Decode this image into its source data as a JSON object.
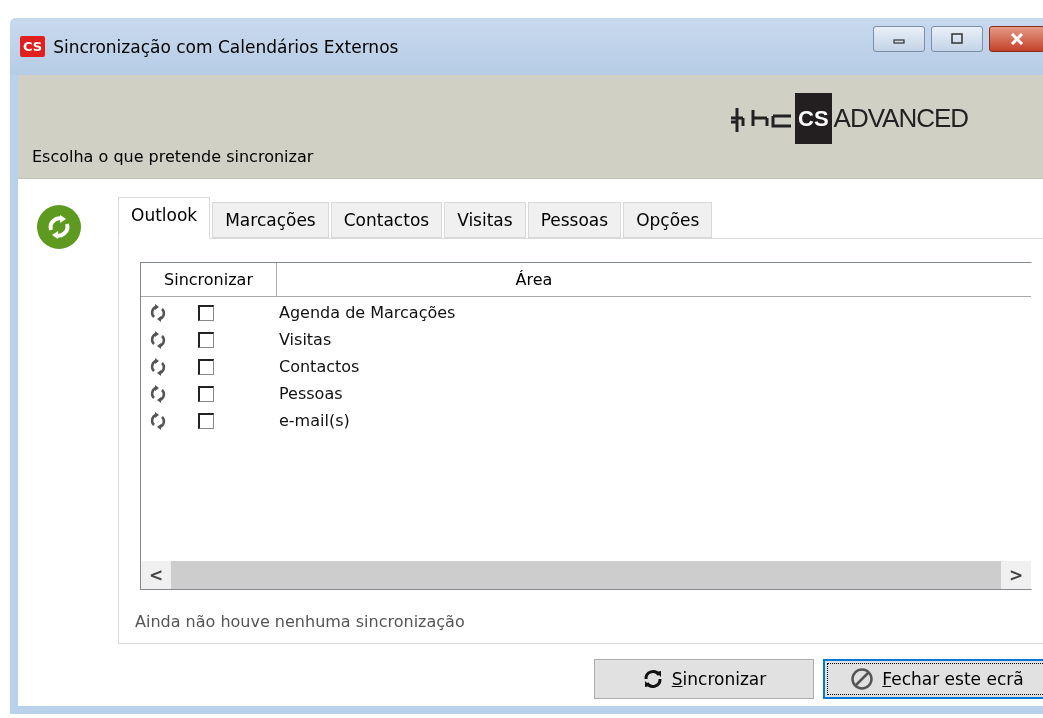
{
  "window": {
    "title": "Sincronização com Calendários Externos",
    "app_badge": "CS"
  },
  "header": {
    "instruction": "Escolha o que pretende sincronizar",
    "logo_badge": "CS",
    "logo_text": "ADVANCED"
  },
  "tabs": [
    {
      "label": "Outlook",
      "selected": true
    },
    {
      "label": "Marcações",
      "selected": false
    },
    {
      "label": "Contactos",
      "selected": false
    },
    {
      "label": "Visitas",
      "selected": false
    },
    {
      "label": "Pessoas",
      "selected": false
    },
    {
      "label": "Opções",
      "selected": false
    }
  ],
  "table": {
    "columns": [
      "Sincronizar",
      "Área"
    ],
    "rows": [
      {
        "area": "Agenda de Marcações",
        "checked": false
      },
      {
        "area": "Visitas",
        "checked": false
      },
      {
        "area": "Contactos",
        "checked": false
      },
      {
        "area": "Pessoas",
        "checked": false
      },
      {
        "area": "e-mail(s)",
        "checked": false
      }
    ],
    "scroll_left": "<",
    "scroll_right": ">"
  },
  "status": "Ainda não houve nenhuma sincronização",
  "buttons": [
    {
      "kind": "sync",
      "accel": "S",
      "label_rest": "incronizar",
      "focused": false
    },
    {
      "kind": "close",
      "accel": "F",
      "label_rest": "echar este ecrã",
      "focused": true
    }
  ]
}
